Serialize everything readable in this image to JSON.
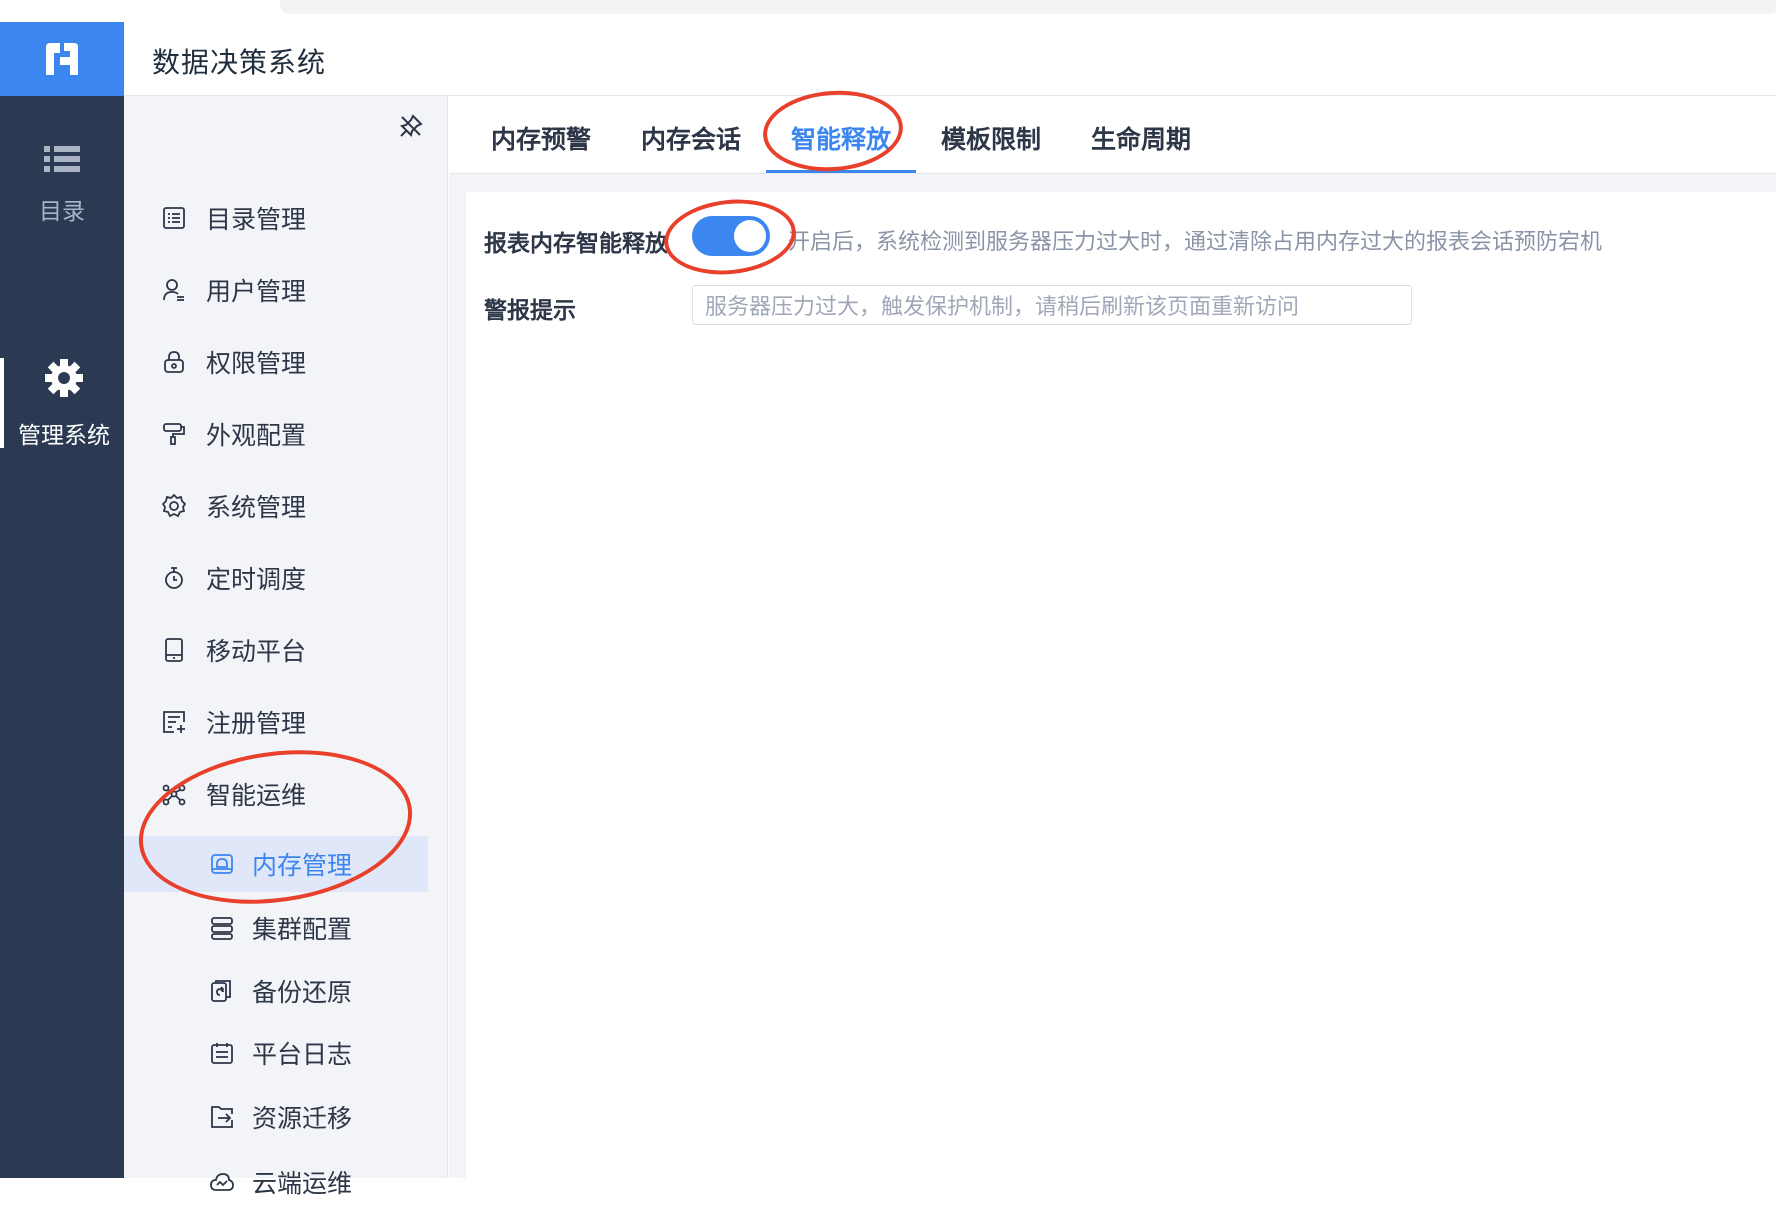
{
  "app": {
    "title": "数据决策系统"
  },
  "rail": {
    "items": [
      {
        "label": "目录",
        "icon": "list-icon"
      },
      {
        "label": "管理系统",
        "icon": "gear-icon"
      }
    ]
  },
  "sidebar": {
    "items": [
      {
        "label": "目录管理",
        "icon": "catalog-icon"
      },
      {
        "label": "用户管理",
        "icon": "user-icon"
      },
      {
        "label": "权限管理",
        "icon": "lock-icon"
      },
      {
        "label": "外观配置",
        "icon": "paint-roller-icon"
      },
      {
        "label": "系统管理",
        "icon": "settings-icon"
      },
      {
        "label": "定时调度",
        "icon": "stopwatch-icon"
      },
      {
        "label": "移动平台",
        "icon": "tablet-icon"
      },
      {
        "label": "注册管理",
        "icon": "register-icon"
      },
      {
        "label": "智能运维",
        "icon": "ops-icon"
      }
    ],
    "subitems": [
      {
        "label": "内存管理",
        "icon": "memory-icon",
        "selected": true
      },
      {
        "label": "集群配置",
        "icon": "cluster-icon"
      },
      {
        "label": "备份还原",
        "icon": "backup-icon"
      },
      {
        "label": "平台日志",
        "icon": "log-icon"
      },
      {
        "label": "资源迁移",
        "icon": "migrate-icon"
      },
      {
        "label": "云端运维",
        "icon": "cloud-icon"
      }
    ]
  },
  "tabs": [
    {
      "label": "内存预警"
    },
    {
      "label": "内存会话"
    },
    {
      "label": "智能释放",
      "active": true
    },
    {
      "label": "模板限制"
    },
    {
      "label": "生命周期"
    }
  ],
  "settings": {
    "smart_release": {
      "label": "报表内存智能释放",
      "enabled": true,
      "hint": "开启后，系统检测到服务器压力过大时，通过清除占用内存过大的报表会话预防宕机"
    },
    "alarm": {
      "label": "警报提示",
      "value": "服务器压力过大，触发保护机制，请稍后刷新该页面重新访问"
    }
  },
  "colors": {
    "accent": "#3c86f0",
    "rail_bg": "#2b3a52",
    "annotation": "#e8402a"
  }
}
